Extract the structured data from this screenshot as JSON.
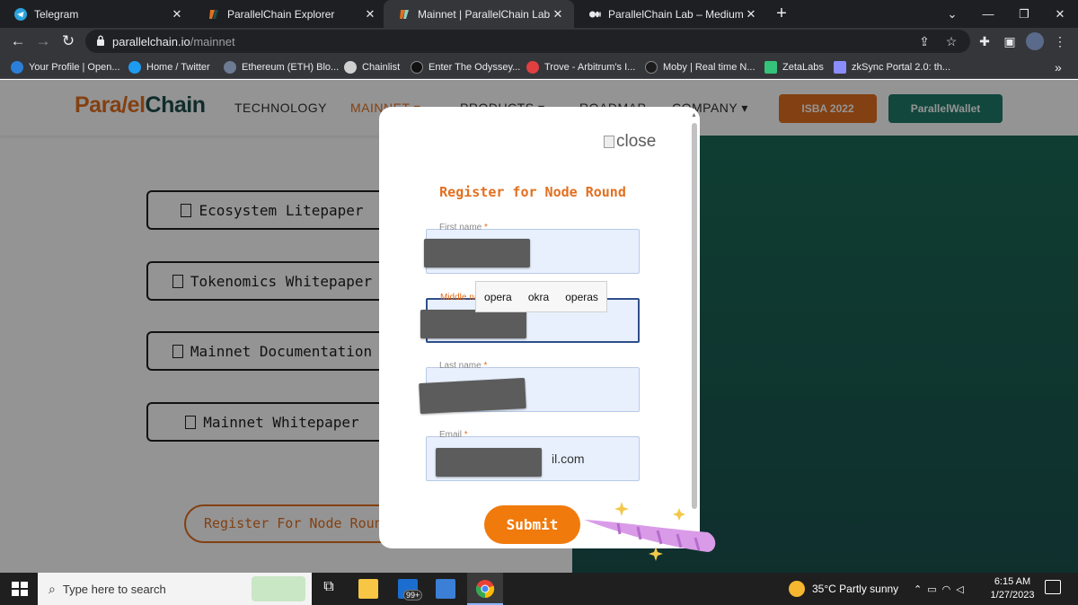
{
  "browser": {
    "tabs": [
      {
        "label": "Telegram",
        "icon": "telegram-icon",
        "active": false
      },
      {
        "label": "ParallelChain Explorer",
        "icon": "parallelchain-icon",
        "active": false
      },
      {
        "label": "Mainnet | ParallelChain Lab",
        "icon": "parallelchain-icon",
        "active": true
      },
      {
        "label": "ParallelChain Lab – Medium",
        "icon": "medium-icon",
        "active": false
      }
    ],
    "url_host": "parallelchain.io",
    "url_path": "/mainnet",
    "bookmarks": [
      {
        "label": "Your Profile | Open...",
        "icon": "opensea-icon",
        "color": "#2b7fd8"
      },
      {
        "label": "Home / Twitter",
        "icon": "twitter-icon",
        "color": "#1d9bf0"
      },
      {
        "label": "Ethereum (ETH) Blo...",
        "icon": "etherscan-icon",
        "color": "#6c7a92"
      },
      {
        "label": "Chainlist",
        "icon": "chainlist-icon",
        "color": "#d0d0d0"
      },
      {
        "label": "Enter The Odyssey...",
        "icon": "odyssey-icon",
        "color": "#111111"
      },
      {
        "label": "Trove - Arbitrum's I...",
        "icon": "trove-icon",
        "color": "#e04040"
      },
      {
        "label": "Moby | Real time N...",
        "icon": "moby-icon",
        "color": "#1c1c1c"
      },
      {
        "label": "ZetaLabs",
        "icon": "zetalabs-icon",
        "color": "#35c27a"
      },
      {
        "label": "zkSync Portal 2.0: th...",
        "icon": "zksync-icon",
        "color": "#8c8dfc"
      }
    ]
  },
  "site": {
    "logo_left": "Para",
    "logo_mid": "/",
    "logo_right_a": "el",
    "logo_right_b": "Chain",
    "nav": {
      "technology": "TECHNOLOGY",
      "mainnet": "MAINNET",
      "products": "PRODUCTS",
      "roadmap": "ROADMAP",
      "company": "COMPANY"
    },
    "isba_label": "ISBA 2022",
    "wallet_label": "ParallelWallet",
    "colors": {
      "brand_orange": "#e26f1f",
      "brand_teal": "#1d4c4a",
      "panel_green": "#1a6a56"
    },
    "doc_buttons": [
      "Ecosystem Litepaper",
      "Tokenomics Whitepaper",
      "Mainnet Documentation",
      "Mainnet Whitepaper"
    ],
    "register_pill": "Register For Node Round"
  },
  "modal": {
    "close_alt": "close",
    "title": "Register for Node Round",
    "fields": {
      "first_name": {
        "label": "First name",
        "required": "*"
      },
      "middle_name": {
        "label": "Middle na",
        "required": ""
      },
      "last_name": {
        "label": "Last name",
        "required": "*"
      },
      "email": {
        "label": "Email",
        "required": "*",
        "visible_value": "il.com"
      }
    },
    "autocomplete": [
      "opera",
      "okra",
      "operas"
    ],
    "submit_label": "Submit"
  },
  "taskbar": {
    "search_placeholder": "Type here to search",
    "mail_badge": "99+",
    "weather": "35°C  Partly sunny",
    "time": "6:15 AM",
    "date": "1/27/2023"
  }
}
